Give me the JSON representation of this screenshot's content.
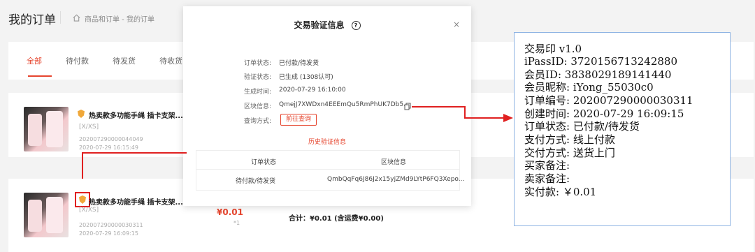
{
  "header": {
    "title": "我的订单",
    "breadcrumb": "商品和订单 - 我的订单"
  },
  "tabs": [
    "全部",
    "待付款",
    "待发货",
    "待收货"
  ],
  "orders": [
    {
      "product_name": "热卖款多功能手绳 插卡支架...",
      "spec": "[X/XS]",
      "order_no": "202007290000044049",
      "time": "2020-07-29 16:15:49"
    },
    {
      "product_name": "热卖款多功能手绳 插卡支架...",
      "spec": "[X/XS]",
      "order_no": "202007290000030311",
      "time": "2020-07-29 16:09:15",
      "price": "¥0.01",
      "qty": "*1",
      "total": "合计：¥0.01 (含运费¥0.00)"
    }
  ],
  "modal": {
    "title": "交易验证信息",
    "help_icon": "?",
    "close": "×",
    "fields": [
      {
        "label": "订单状态:",
        "value": "已付款/待发货"
      },
      {
        "label": "验证状态:",
        "value": "已生成 (1308认可)"
      },
      {
        "label": "生成时间:",
        "value": "2020-07-29 16:10:00"
      },
      {
        "label": "区块信息:",
        "value": "QmejJ7XWDxn4EEEmQu5RmPhUK7Db5..."
      },
      {
        "label": "查询方式:",
        "value": ""
      }
    ],
    "query_button": "前往查询",
    "history_link": "历史验证信息",
    "table": {
      "headers": [
        "订单状态",
        "区块信息"
      ],
      "row": [
        "待付款/待发货",
        "QmbQqFq6J86J2x15yjZMd9LYtP6FQ3Xepo..."
      ]
    }
  },
  "receipt": {
    "lines": [
      "交易印 v1.0",
      "iPassID: 3720156713242880",
      "会员ID: 3838029189141440",
      "会员昵称: iYong_55030c0",
      "订单编号: 202007290000030311",
      "创建时间: 2020-07-29 16:09:15",
      "订单状态: 已付款/待发货",
      "支付方式: 线上付款",
      "交付方式: 送货上门",
      "买家备注:",
      "卖家备注:",
      "实付款: ￥0.01"
    ]
  },
  "colors": {
    "accent": "#e6452e",
    "highlight": "#e02020",
    "receipt_border": "#8fb4e3"
  }
}
